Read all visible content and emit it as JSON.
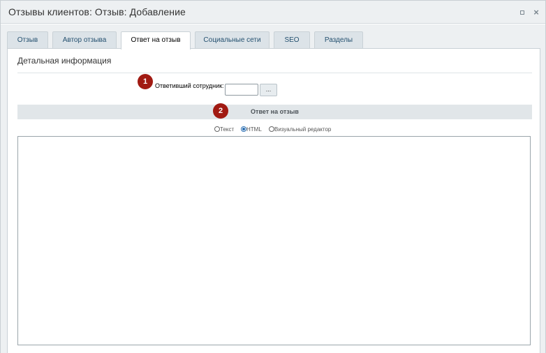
{
  "window": {
    "title": "Отзывы клиентов: Отзыв: Добавление",
    "minimize_icon": "square-icon",
    "close_icon": "close-icon",
    "close_glyph": "×"
  },
  "tabs": [
    {
      "label": "Отзыв",
      "active": false
    },
    {
      "label": "Автор отзыва",
      "active": false
    },
    {
      "label": "Ответ на отзыв",
      "active": true
    },
    {
      "label": "Социальные сети",
      "active": false
    },
    {
      "label": "SEO",
      "active": false
    },
    {
      "label": "Разделы",
      "active": false
    }
  ],
  "section": {
    "title": "Детальная информация"
  },
  "badges": {
    "one": "1",
    "two": "2",
    "color": "#a11a12"
  },
  "responder": {
    "label": "Ответивший сотрудник:",
    "value": "",
    "button_label": "..."
  },
  "reply_group": {
    "title": "Ответ на отзыв"
  },
  "editor_mode": {
    "options": [
      {
        "label": "Текст",
        "checked": false
      },
      {
        "label": "HTML",
        "checked": true
      },
      {
        "label": "Визуальный редактор",
        "checked": false
      }
    ]
  },
  "editor": {
    "value": ""
  },
  "colors": {
    "accent": "#2c6fb3",
    "badge": "#a11a12",
    "tab_text": "#24506f"
  }
}
